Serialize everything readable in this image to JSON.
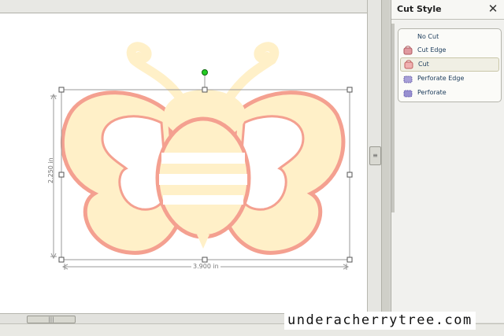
{
  "canvas": {
    "height_dimension": "2.250 in",
    "width_dimension": "3.900 in",
    "artwork": "bee-butterfly"
  },
  "panel": {
    "title": "Cut Style",
    "items": [
      {
        "label": "No Cut",
        "icon": "no-cut-icon",
        "selected": false
      },
      {
        "label": "Cut Edge",
        "icon": "cut-edge-icon",
        "selected": false
      },
      {
        "label": "Cut",
        "icon": "cut-icon",
        "selected": true
      },
      {
        "label": "Perforate Edge",
        "icon": "perforate-edge-icon",
        "selected": false
      },
      {
        "label": "Perforate",
        "icon": "perforate-icon",
        "selected": false
      }
    ]
  },
  "watermark": "underacherrytree.com",
  "colors": {
    "fill": "#fff0c8",
    "outline": "#f4a090",
    "handle_green": "#22cc22"
  }
}
